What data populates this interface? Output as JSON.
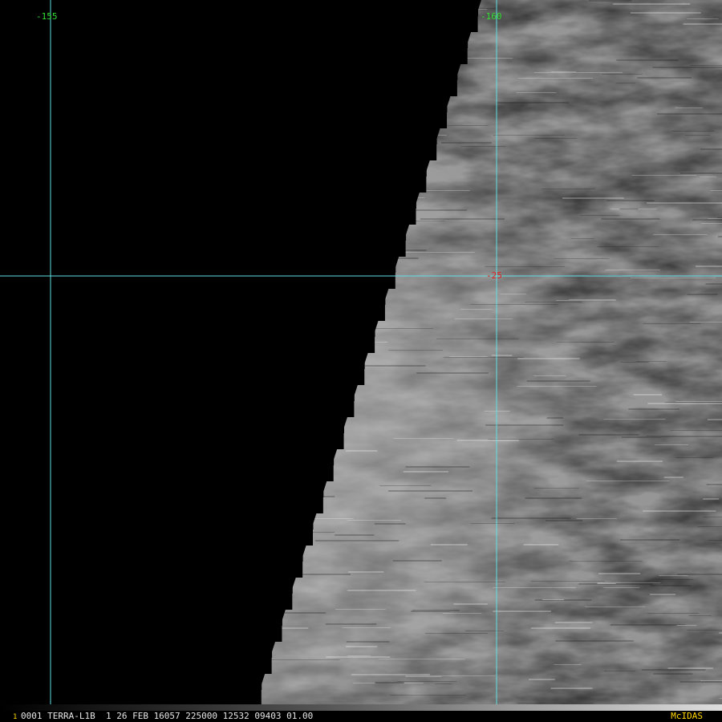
{
  "viewer": {
    "longitude_labels": [
      "-155",
      "-160"
    ],
    "latitude_labels": [
      "-25"
    ],
    "grid_line_color": "#5fe0e0",
    "longitude_label_color": "#33dd33",
    "latitude_label_color": "#dd2222"
  },
  "imagery": {
    "background_color": "#000000",
    "cloud_colors": [
      "#3a3a3a",
      "#6e6e6e",
      "#9b9b9b",
      "#c4c4c4"
    ]
  },
  "status": {
    "frame_number": "1",
    "text": "0001 TERRA-L1B  1 26 FEB 16057 225000 12532 09403 01.00",
    "brand": "McIDAS",
    "brand_color": "#ffd700"
  }
}
